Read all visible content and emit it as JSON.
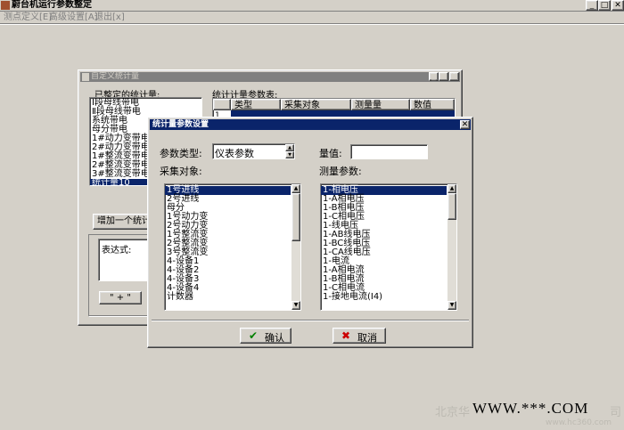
{
  "main_window": {
    "title": "蔚台机运行参数整定",
    "menu": [
      "测点定义[E]",
      "高级设置[A]",
      "退出[x]"
    ]
  },
  "stat_window": {
    "title": "自定义统计量",
    "defined_label": "已整定的统计量:",
    "defined_items": [
      "Ⅰ段母线带电",
      "Ⅱ段母线带电",
      "系统带电",
      "母分带电",
      "1#动力变带电",
      "2#动力变带电",
      "1#整流变带电",
      "2#整流变带电",
      "3#整流变带电",
      "统计量10"
    ],
    "params_table_label": "统计计量参数表:",
    "table_headers": [
      "类型",
      "采集对象",
      "测量量",
      "数值"
    ],
    "row_number": "1",
    "add_button": "增加一个统计",
    "expression_label": "表达式:",
    "plus_button": "\" + \""
  },
  "param_dialog": {
    "title": "统计量参数设置",
    "param_type_label": "参数类型:",
    "param_type_value": "仪表参数",
    "value_label": "量值:",
    "value_input": "",
    "collect_label": "采集对象:",
    "collect_items": [
      "1号进线",
      "2号进线",
      "母分",
      "1号动力变",
      "2号动力变",
      "1号整流变",
      "2号整流变",
      "3号整流变",
      "4-设备1",
      "4-设备2",
      "4-设备3",
      "4-设备4",
      "计数器"
    ],
    "measure_label": "测量参数:",
    "measure_items": [
      "1-相电压",
      "1-A相电压",
      "1-B相电压",
      "1-C相电压",
      "1-线电压",
      "1-AB线电压",
      "1-BC线电压",
      "1-CA线电压",
      "1-电流",
      "1-A相电流",
      "1-B相电流",
      "1-C相电流",
      "1-接地电流(I4)"
    ],
    "ok_button": "确认",
    "cancel_button": "取消"
  },
  "watermark": {
    "text": "WWW.***.COM",
    "company": "北京华",
    "company_tail": "司",
    "sub": "www.hc360.com"
  },
  "colors": {
    "face": "#d4d0c8",
    "active_title": "#0a246a",
    "inactive_title": "#808080",
    "selection": "#0a246a"
  }
}
